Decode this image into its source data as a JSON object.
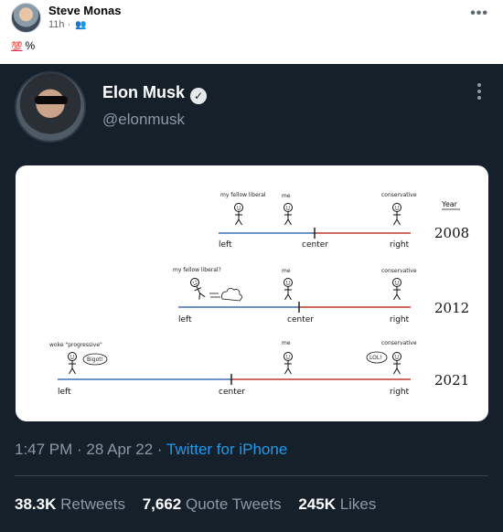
{
  "facebook": {
    "author": "Steve Monas",
    "time": "11h",
    "audience_icon": "friends-icon",
    "more_icon": "ellipsis-icon",
    "post_emoji": "💯",
    "post_text": "%"
  },
  "tweet": {
    "name": "Elon Musk",
    "verified_icon": "verified-badge-icon",
    "handle": "@elonmusk",
    "time": "1:47 PM · 28 Apr 22 · ",
    "source": "Twitter for iPhone",
    "stats": {
      "retweets_count": "38.3K",
      "retweets_label": "Retweets",
      "quotes_count": "7,662",
      "quotes_label": "Quote Tweets",
      "likes_count": "245K",
      "likes_label": "Likes"
    },
    "image": {
      "year_header": "Year",
      "rows": [
        {
          "year": "2008",
          "caption_liberal": "my fellow liberal",
          "caption_me": "me",
          "caption_conservative": "conservative",
          "left": "left",
          "center": "center",
          "right": "right"
        },
        {
          "year": "2012",
          "caption_liberal": "my fellow liberal?",
          "caption_me": "me",
          "caption_conservative": "conservative",
          "left": "left",
          "center": "center",
          "right": "right"
        },
        {
          "year": "2021",
          "caption_liberal": "woke \"progressive\"",
          "caption_me": "me",
          "caption_conservative": "conservative",
          "speech_left": "Bigot!",
          "speech_right": "LOL!",
          "left": "left",
          "center": "center",
          "right": "right"
        }
      ],
      "colors": {
        "left_line": "#3b6fb6",
        "right_line": "#c0392b"
      }
    }
  }
}
